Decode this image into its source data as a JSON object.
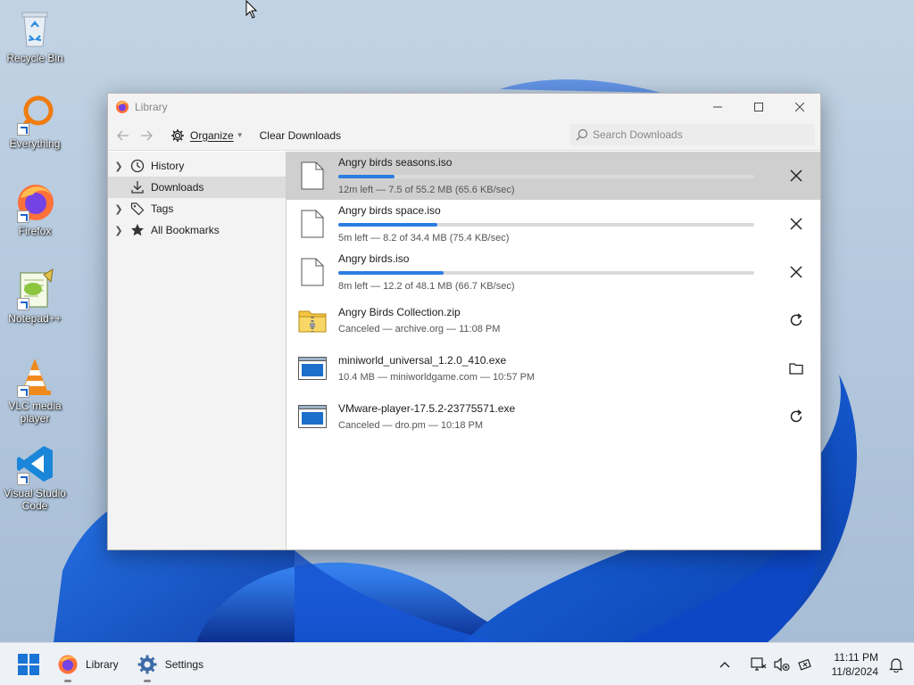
{
  "desktop": {
    "icons": [
      {
        "label": "Recycle Bin"
      },
      {
        "label": "Everything"
      },
      {
        "label": "Firefox"
      },
      {
        "label": "Notepad++"
      },
      {
        "label": "VLC media player"
      },
      {
        "label": "Visual Studio Code"
      }
    ]
  },
  "window": {
    "title": "Library",
    "controls": {
      "minimize": "minimize-icon",
      "maximize": "maximize-icon",
      "close": "close-icon"
    }
  },
  "toolbar": {
    "organize_label": "Organize",
    "clear_label": "Clear Downloads",
    "search_placeholder": "Search Downloads"
  },
  "sidebar": {
    "items": [
      {
        "label": "History",
        "icon": "clock-icon",
        "expandable": true,
        "selected": false
      },
      {
        "label": "Downloads",
        "icon": "download-icon",
        "expandable": false,
        "selected": true
      },
      {
        "label": "Tags",
        "icon": "tag-icon",
        "expandable": true,
        "selected": false
      },
      {
        "label": "All Bookmarks",
        "icon": "star-icon",
        "expandable": true,
        "selected": false
      }
    ]
  },
  "downloads": [
    {
      "name": "Angry birds seasons.iso",
      "status": "12m left — 7.5 of 55.2 MB (65.6 KB/sec)",
      "progress": 0.136,
      "in_progress": true,
      "file_icon": "file-icon",
      "action": "cancel-icon",
      "selected": true
    },
    {
      "name": "Angry birds space.iso",
      "status": "5m left — 8.2 of 34.4 MB (75.4 KB/sec)",
      "progress": 0.238,
      "in_progress": true,
      "file_icon": "file-icon",
      "action": "cancel-icon",
      "selected": false
    },
    {
      "name": "Angry birds.iso",
      "status": "8m left — 12.2 of 48.1 MB (66.7 KB/sec)",
      "progress": 0.254,
      "in_progress": true,
      "file_icon": "file-icon",
      "action": "cancel-icon",
      "selected": false
    },
    {
      "name": "Angry Birds Collection.zip",
      "status": "Canceled — archive.org — 11:08 PM",
      "in_progress": false,
      "file_icon": "zip-icon",
      "action": "retry-icon",
      "selected": false
    },
    {
      "name": "miniworld_universal_1.2.0_410.exe",
      "status": "10.4 MB — miniworldgame.com — 10:57 PM",
      "in_progress": false,
      "file_icon": "exe-icon",
      "action": "folder-icon",
      "selected": false
    },
    {
      "name": "VMware-player-17.5.2-23775571.exe",
      "status": "Canceled — dro.pm — 10:18 PM",
      "in_progress": false,
      "file_icon": "exe-icon",
      "action": "retry-icon",
      "selected": false
    }
  ],
  "taskbar": {
    "apps": [
      {
        "label": "Library",
        "icon": "firefox-icon"
      },
      {
        "label": "Settings",
        "icon": "gear-icon"
      }
    ],
    "tray": {
      "time": "11:11 PM",
      "date": "11/8/2024"
    }
  },
  "colors": {
    "accent": "#2a7de1",
    "taskbar_bg": "#eef1f5",
    "selected_row": "#cfcfcf"
  }
}
